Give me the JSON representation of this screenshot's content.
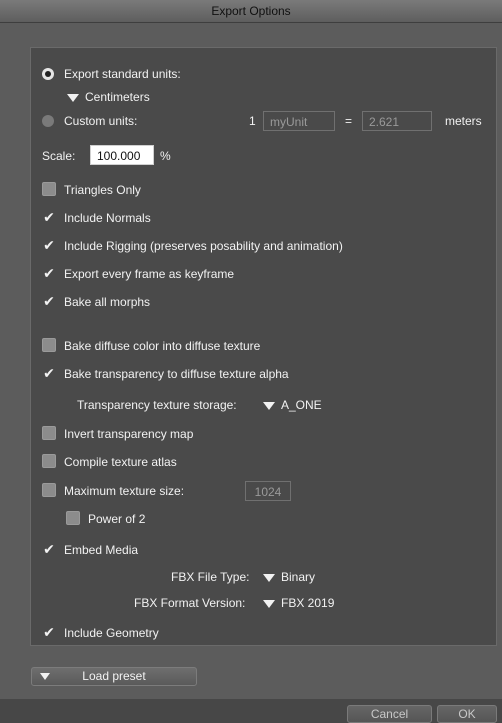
{
  "window": {
    "title": "Export Options"
  },
  "units": {
    "standard_label": "Export standard units:",
    "standard_value": "Centimeters",
    "custom_label": "Custom units:",
    "custom_count": "1",
    "custom_unit_placeholder": "myUnit",
    "equals": "=",
    "custom_factor": "2.621",
    "meters_label": "meters"
  },
  "scale": {
    "label": "Scale:",
    "value": "100.000",
    "unit": "%"
  },
  "options": {
    "triangles_only": "Triangles Only",
    "include_normals": "Include Normals",
    "include_rigging": "Include Rigging (preserves posability and animation)",
    "every_frame": "Export every frame as keyframe",
    "bake_morphs": "Bake all morphs",
    "bake_diffuse": "Bake diffuse color into diffuse texture",
    "bake_transparency": "Bake transparency to diffuse texture alpha",
    "invert_transparency": "Invert transparency map",
    "compile_atlas": "Compile texture atlas",
    "max_texture_size": "Maximum texture size:",
    "power_of_2": "Power of 2",
    "embed_media": "Embed Media",
    "include_geometry": "Include Geometry"
  },
  "transparency_storage": {
    "label": "Transparency texture storage:",
    "value": "A_ONE"
  },
  "max_texture_value": "1024",
  "fbx": {
    "file_type_label": "FBX File Type:",
    "file_type_value": "Binary",
    "format_version_label": "FBX Format Version:",
    "format_version_value": "FBX 2019"
  },
  "buttons": {
    "load_preset": "Load preset",
    "cancel": "Cancel",
    "ok": "OK"
  }
}
